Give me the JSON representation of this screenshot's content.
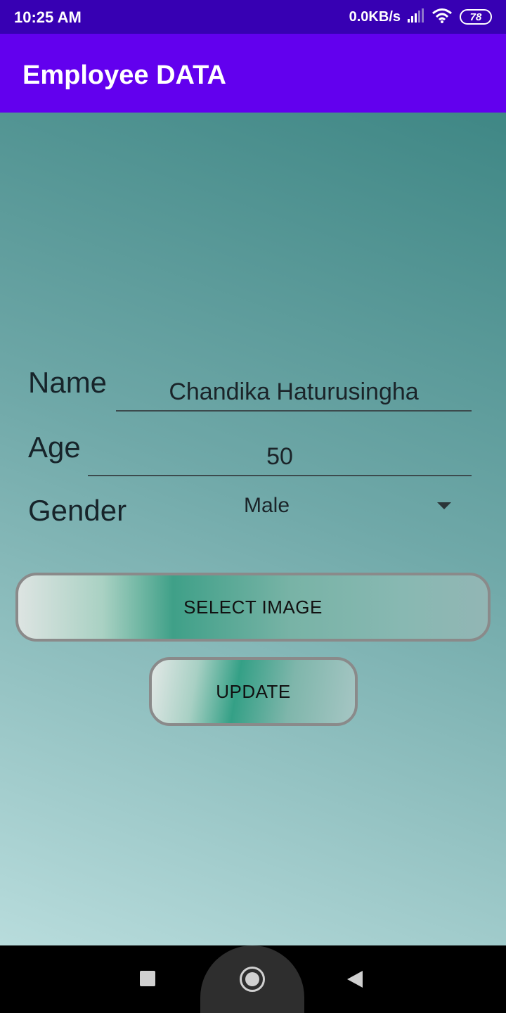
{
  "status_bar": {
    "time": "10:25 AM",
    "network_speed": "0.0KB/s",
    "battery": "78"
  },
  "app_bar": {
    "title": "Employee DATA"
  },
  "form": {
    "name_label": "Name",
    "name_value": "Chandika Haturusingha",
    "age_label": "Age",
    "age_value": "50",
    "gender_label": "Gender",
    "gender_selected": "Male"
  },
  "buttons": {
    "select_image": "SELECT IMAGE",
    "update": "UPDATE"
  },
  "colors": {
    "status_bar": "#3700b3",
    "app_bar": "#6200ee",
    "accent_teal": "#3fa088"
  },
  "icons": [
    "signal-icon",
    "wifi-icon",
    "battery-icon",
    "dropdown-arrow-icon",
    "recents-icon",
    "home-icon",
    "back-icon"
  ]
}
